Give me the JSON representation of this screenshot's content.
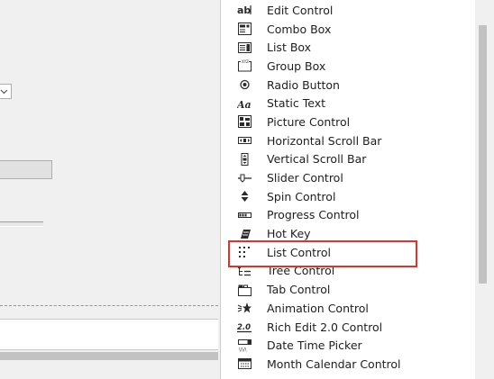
{
  "toolbox": {
    "items": [
      {
        "label": "Edit Control",
        "icon": "edit-control-icon"
      },
      {
        "label": "Combo Box",
        "icon": "combo-box-icon"
      },
      {
        "label": "List Box",
        "icon": "list-box-icon"
      },
      {
        "label": "Group Box",
        "icon": "group-box-icon"
      },
      {
        "label": "Radio Button",
        "icon": "radio-button-icon"
      },
      {
        "label": "Static Text",
        "icon": "static-text-icon"
      },
      {
        "label": "Picture Control",
        "icon": "picture-control-icon"
      },
      {
        "label": "Horizontal Scroll Bar",
        "icon": "horizontal-scroll-bar-icon"
      },
      {
        "label": "Vertical Scroll Bar",
        "icon": "vertical-scroll-bar-icon"
      },
      {
        "label": "Slider Control",
        "icon": "slider-control-icon"
      },
      {
        "label": "Spin Control",
        "icon": "spin-control-icon"
      },
      {
        "label": "Progress Control",
        "icon": "progress-control-icon"
      },
      {
        "label": "Hot Key",
        "icon": "hot-key-icon"
      },
      {
        "label": "List Control",
        "icon": "list-control-icon"
      },
      {
        "label": "Tree Control",
        "icon": "tree-control-icon"
      },
      {
        "label": "Tab Control",
        "icon": "tab-control-icon"
      },
      {
        "label": "Animation Control",
        "icon": "animation-control-icon"
      },
      {
        "label": "Rich Edit 2.0 Control",
        "icon": "rich-edit-icon"
      },
      {
        "label": "Date Time Picker",
        "icon": "date-time-picker-icon"
      },
      {
        "label": "Month Calendar Control",
        "icon": "month-calendar-icon"
      }
    ],
    "highlighted_item": "List Control"
  },
  "colors": {
    "highlight": "#e0312b",
    "panel_background": "#ffffff",
    "designer_background": "#f0f0f0",
    "icon": "#2b2b2b"
  }
}
